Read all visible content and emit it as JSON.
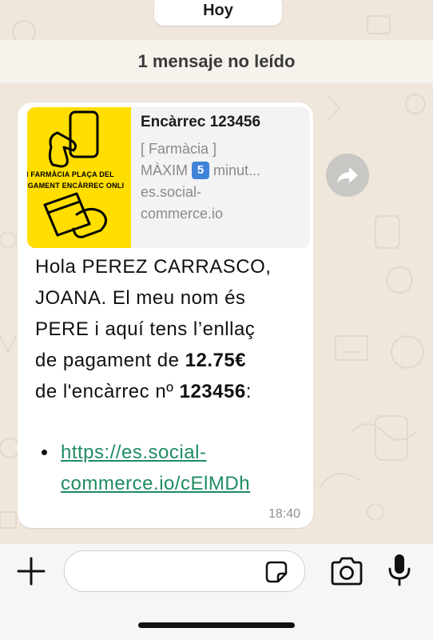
{
  "chat": {
    "day_label": "Hoy",
    "unread_banner": "1 mensaje no leído"
  },
  "message": {
    "preview": {
      "title": "Encàrrec 123456",
      "line1": "[ Farmàcia ]",
      "line2_prefix": "MÀXIM",
      "line2_badge": "5",
      "line2_suffix": "minut...",
      "domain_line1": "es.social-",
      "domain_line2": "commerce.io",
      "image_text1": "M FARMÀCIA PLAÇA DEL",
      "image_text2": "AGAMENT ENCÀRREC ONLI"
    },
    "body": {
      "line1": "Hola PEREZ CARRASCO,",
      "line2": "JOANA. El meu nom és",
      "line3": "PERE i aquí tens l’enllaç",
      "line4_prefix": "de pagament de ",
      "amount": "12.75€",
      "line5_prefix": "de l'encàrrec nº ",
      "order_number": "123456",
      "line5_suffix": ":"
    },
    "link_line1": "https://es.social-",
    "link_line2": "commerce.io/cElMDh",
    "time": "18:40"
  },
  "colors": {
    "wallpaper": "#efe7dc",
    "bubble": "#ffffff",
    "link": "#1f8c61",
    "thumbnail": "#ffde00"
  },
  "icons": [
    "forward-icon",
    "plus-icon",
    "sticker-icon",
    "camera-icon",
    "microphone-icon"
  ]
}
